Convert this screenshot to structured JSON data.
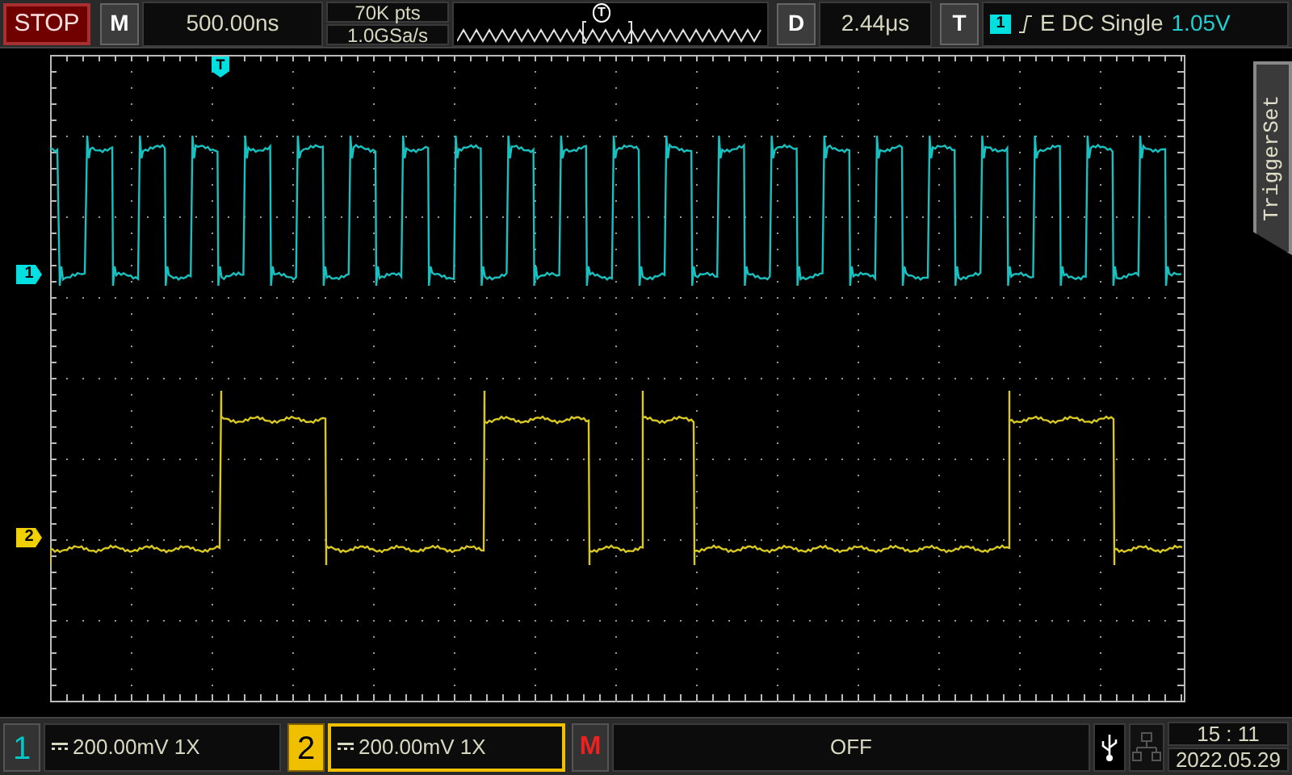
{
  "run_button": {
    "label": "STOP",
    "running": false
  },
  "menu_button": "M",
  "timebase": "500.00ns",
  "acquisition": {
    "memory_depth": "70K pts",
    "sample_rate": "1.0GSa/s"
  },
  "overview_trigger_marker": "T",
  "delay_button": "D",
  "delay": "2.44μs",
  "trigger_button": "T",
  "trigger": {
    "source": "1",
    "settings": "E DC Single",
    "level": "1.05V"
  },
  "side_tab": "TriggerSet",
  "grid_trigger_marker": "T",
  "channel_markers": [
    {
      "label": "1",
      "color": "#00e0e0"
    },
    {
      "label": "2",
      "color": "#f0d000"
    }
  ],
  "channels": [
    {
      "number": "1",
      "scale": "200.00mV 1X",
      "selected": false,
      "color": "#00c8c8"
    },
    {
      "number": "2",
      "scale": "200.00mV 1X",
      "selected": true,
      "color": "#f0c000"
    }
  ],
  "math_button": "M",
  "math_status": "OFF",
  "clock": {
    "time": "15 : 11",
    "date": "2022.05.29"
  }
}
